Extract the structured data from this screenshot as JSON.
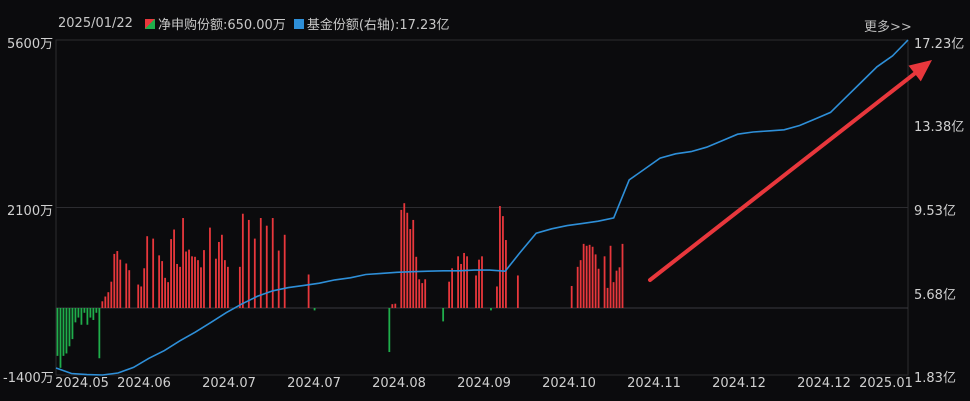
{
  "legend": {
    "date": "2025/01/22",
    "series1_text": "净申购份额:650.00万",
    "series2_text": "基金份额(右轴):17.23亿"
  },
  "more_label": "更多>>",
  "colors": {
    "positive": "#e8373c",
    "negative": "#1fae4b",
    "line": "#2e8fd8",
    "arrow": "#e8373c",
    "grid": "#2c2c30"
  },
  "chart_data": {
    "type": "bar+line",
    "series": [
      {
        "name": "净申购份额",
        "unit": "万",
        "values": [
          -1000,
          -1250,
          -1000,
          -950,
          -800,
          -650,
          -300,
          -200,
          -350,
          -100,
          -350,
          -200,
          -250,
          -100,
          -1050,
          140,
          240,
          330,
          550,
          1130,
          1190,
          1010,
          0,
          930,
          790,
          0,
          0,
          490,
          450,
          830,
          1500,
          0,
          1450,
          0,
          1100,
          980,
          630,
          540,
          1440,
          1640,
          920,
          860,
          1880,
          1180,
          1220,
          1080,
          1070,
          1000,
          850,
          1210,
          0,
          1680,
          0,
          1030,
          1380,
          1530,
          1000,
          860,
          0,
          0,
          0,
          860,
          1970,
          0,
          1840,
          0,
          1450,
          0,
          1880,
          0,
          1720,
          0,
          1880,
          0,
          1200,
          0,
          1530,
          0,
          0,
          0,
          0,
          0,
          0,
          0,
          700,
          0,
          -50,
          0,
          0,
          0,
          0,
          0,
          0,
          0,
          0,
          0,
          0,
          0,
          0,
          0,
          0,
          0,
          0,
          0,
          0,
          0,
          0,
          0,
          0,
          0,
          0,
          -920,
          80,
          90,
          0,
          2050,
          2190,
          1990,
          1650,
          1840,
          1070,
          600,
          520,
          600,
          0,
          0,
          0,
          0,
          0,
          -280,
          0,
          550,
          830,
          0,
          1080,
          920,
          1150,
          1080,
          0,
          0,
          680,
          1010,
          1080,
          0,
          0,
          -50,
          0,
          450,
          2130,
          1920,
          1420,
          0,
          0,
          0,
          680,
          0,
          0,
          0,
          0,
          0,
          0,
          0,
          0,
          0,
          0,
          0,
          0,
          0,
          0,
          0,
          0,
          0,
          460,
          0,
          860,
          1000,
          1340,
          1300,
          1320,
          1280,
          1120,
          820,
          0,
          1080,
          420,
          1300,
          540,
          780,
          850,
          1340,
          0,
          0,
          0,
          0,
          0,
          0,
          0,
          0,
          0,
          0,
          0,
          0,
          0,
          0,
          0,
          0,
          0,
          0,
          0,
          0,
          0,
          0,
          0,
          0,
          0,
          0,
          0,
          0,
          0,
          0,
          0,
          0,
          0,
          0,
          0,
          0,
          0,
          0,
          0,
          0,
          0,
          0,
          0,
          0,
          0,
          0,
          0,
          0,
          0,
          0,
          0,
          0,
          0,
          0,
          0,
          0,
          0,
          0,
          0,
          0,
          0,
          0,
          0,
          0,
          0,
          0,
          0,
          0,
          0,
          0,
          0,
          0,
          0,
          0,
          0,
          0,
          0,
          0,
          0,
          0,
          0,
          0,
          0,
          0,
          0,
          0,
          0,
          0,
          0,
          0,
          0,
          0,
          0,
          0,
          0
        ]
      },
      {
        "name": "基金份额",
        "unit": "亿",
        "axis": "right",
        "values": [
          2.15,
          1.9,
          1.85,
          1.83,
          1.92,
          2.18,
          2.6,
          2.95,
          3.4,
          3.8,
          4.25,
          4.7,
          5.1,
          5.45,
          5.7,
          5.85,
          5.95,
          6.05,
          6.2,
          6.3,
          6.45,
          6.5,
          6.55,
          6.58,
          6.6,
          6.62,
          6.62,
          6.65,
          6.65,
          6.6,
          7.5,
          8.35,
          8.55,
          8.7,
          8.8,
          8.9,
          9.05,
          10.8,
          11.3,
          11.8,
          12.0,
          12.1,
          12.3,
          12.6,
          12.9,
          13.0,
          13.05,
          13.1,
          13.3,
          13.6,
          13.9,
          14.6,
          15.3,
          16.0,
          16.5,
          17.23
        ]
      }
    ],
    "x_ticks": [
      "2024.05",
      "2024.06",
      "2024.07",
      "2024.07",
      "2024.08",
      "2024.09",
      "2024.10",
      "2024.11",
      "2024.12",
      "2024.12",
      "2025.01"
    ],
    "y_left": {
      "ticks": [
        "5600万",
        "2100万",
        "-1400万"
      ],
      "min": -1400,
      "max": 5600
    },
    "y_right": {
      "ticks": [
        "17.23亿",
        "13.38亿",
        "9.53亿",
        "5.68亿",
        "1.83亿"
      ],
      "min": 1.83,
      "max": 17.23
    },
    "annotation": "upward-trend-arrow"
  }
}
